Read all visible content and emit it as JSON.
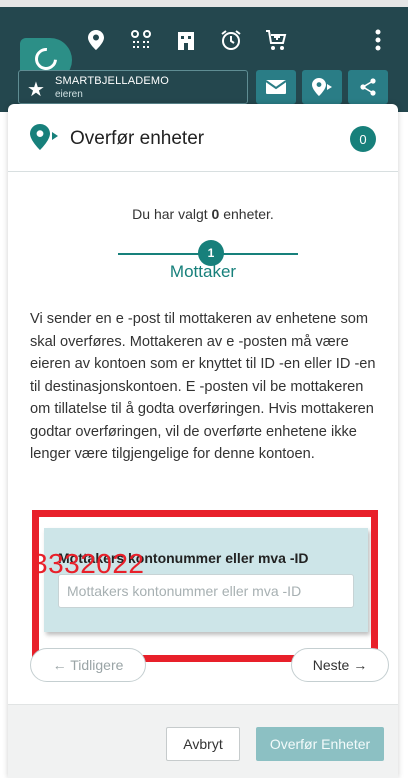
{
  "topbar": {
    "icons": [
      "app-logo-icon",
      "location-pin-icon",
      "route-icon",
      "building-icon",
      "alarm-icon",
      "cart-icon",
      "more-vertical-icon"
    ],
    "account": {
      "name": "SMARTBJELLADEMO",
      "role": "eieren"
    },
    "action_icons": [
      "mail-icon",
      "location-arrow-icon",
      "share-icon"
    ]
  },
  "dialog": {
    "title": "Overfør enheter",
    "count": "0",
    "selected_prefix": "Du har valgt ",
    "selected_count": "0",
    "selected_suffix": " enheter.",
    "step_number": "1",
    "step_label": "Mottaker",
    "body_text": "Vi sender en e -post til mottakeren av enhetene som skal overføres. Mottakeren av e -posten må være eieren av kontoen som er knyttet til ID -en eller ID -en til destinasjonskontoen. E -posten vil be mottakeren om tillatelse til å godta overføringen. Hvis mottakeren godtar overføringen, vil de overførte enhetene ikke lenger være tilgjengelige for denne kontoen.",
    "field_label": "Mottakers kontonummer eller mva -ID",
    "field_placeholder": "Mottakers kontonummer eller mva -ID",
    "typed_value": "3332022",
    "prev_label": "← Tidligere",
    "next_label": "Neste →",
    "cancel_label": "Avbryt",
    "transfer_label": "Overfør Enheter"
  },
  "colors": {
    "topbar": "#24474e",
    "accent": "#17807b",
    "highlight_red": "#e8202a",
    "field_bg": "#cde5e8",
    "disabled_button": "#8cc0c3"
  }
}
